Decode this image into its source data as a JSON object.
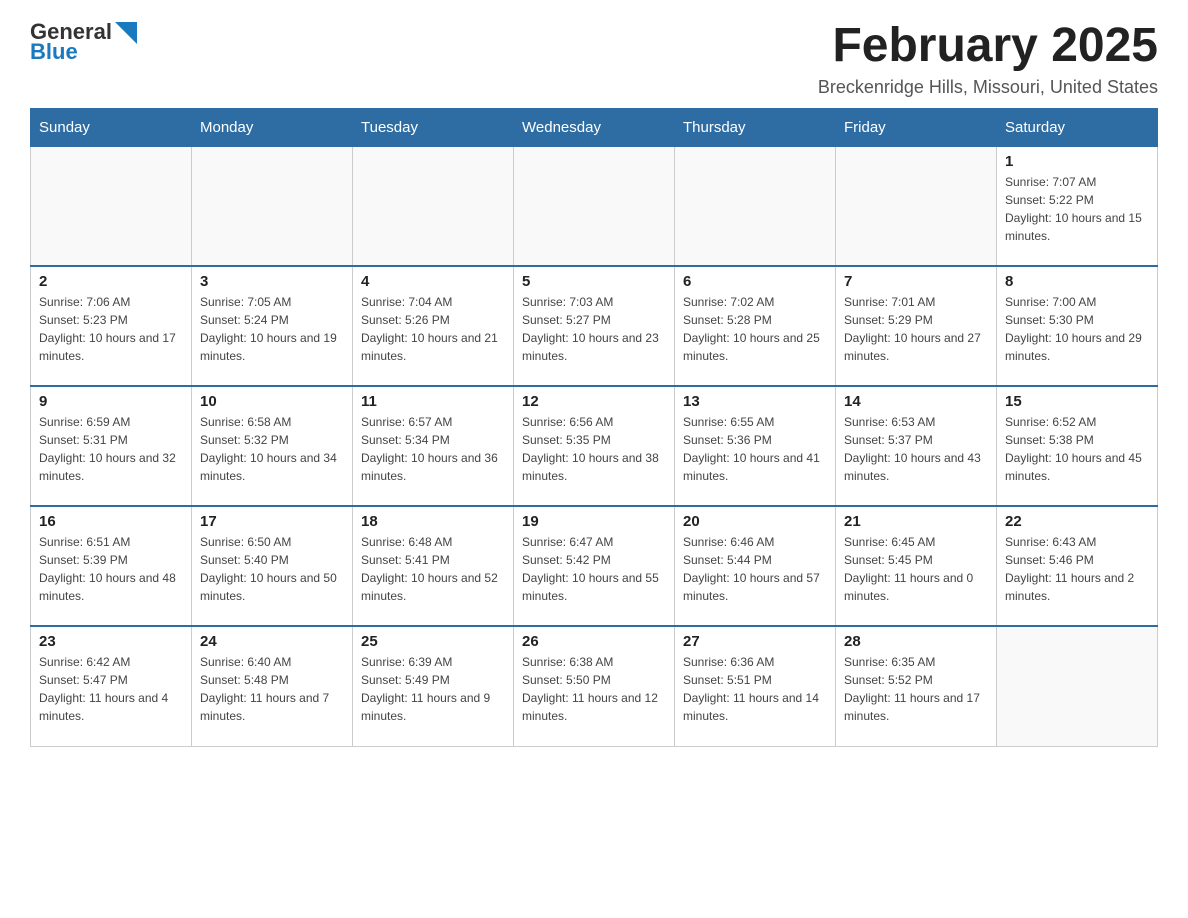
{
  "logo": {
    "text_general": "General",
    "text_blue": "Blue",
    "arrow_color": "#1a7abf"
  },
  "header": {
    "month_title": "February 2025",
    "location": "Breckenridge Hills, Missouri, United States"
  },
  "weekdays": [
    "Sunday",
    "Monday",
    "Tuesday",
    "Wednesday",
    "Thursday",
    "Friday",
    "Saturday"
  ],
  "weeks": [
    [
      {
        "day": "",
        "sunrise": "",
        "sunset": "",
        "daylight": ""
      },
      {
        "day": "",
        "sunrise": "",
        "sunset": "",
        "daylight": ""
      },
      {
        "day": "",
        "sunrise": "",
        "sunset": "",
        "daylight": ""
      },
      {
        "day": "",
        "sunrise": "",
        "sunset": "",
        "daylight": ""
      },
      {
        "day": "",
        "sunrise": "",
        "sunset": "",
        "daylight": ""
      },
      {
        "day": "",
        "sunrise": "",
        "sunset": "",
        "daylight": ""
      },
      {
        "day": "1",
        "sunrise": "Sunrise: 7:07 AM",
        "sunset": "Sunset: 5:22 PM",
        "daylight": "Daylight: 10 hours and 15 minutes."
      }
    ],
    [
      {
        "day": "2",
        "sunrise": "Sunrise: 7:06 AM",
        "sunset": "Sunset: 5:23 PM",
        "daylight": "Daylight: 10 hours and 17 minutes."
      },
      {
        "day": "3",
        "sunrise": "Sunrise: 7:05 AM",
        "sunset": "Sunset: 5:24 PM",
        "daylight": "Daylight: 10 hours and 19 minutes."
      },
      {
        "day": "4",
        "sunrise": "Sunrise: 7:04 AM",
        "sunset": "Sunset: 5:26 PM",
        "daylight": "Daylight: 10 hours and 21 minutes."
      },
      {
        "day": "5",
        "sunrise": "Sunrise: 7:03 AM",
        "sunset": "Sunset: 5:27 PM",
        "daylight": "Daylight: 10 hours and 23 minutes."
      },
      {
        "day": "6",
        "sunrise": "Sunrise: 7:02 AM",
        "sunset": "Sunset: 5:28 PM",
        "daylight": "Daylight: 10 hours and 25 minutes."
      },
      {
        "day": "7",
        "sunrise": "Sunrise: 7:01 AM",
        "sunset": "Sunset: 5:29 PM",
        "daylight": "Daylight: 10 hours and 27 minutes."
      },
      {
        "day": "8",
        "sunrise": "Sunrise: 7:00 AM",
        "sunset": "Sunset: 5:30 PM",
        "daylight": "Daylight: 10 hours and 29 minutes."
      }
    ],
    [
      {
        "day": "9",
        "sunrise": "Sunrise: 6:59 AM",
        "sunset": "Sunset: 5:31 PM",
        "daylight": "Daylight: 10 hours and 32 minutes."
      },
      {
        "day": "10",
        "sunrise": "Sunrise: 6:58 AM",
        "sunset": "Sunset: 5:32 PM",
        "daylight": "Daylight: 10 hours and 34 minutes."
      },
      {
        "day": "11",
        "sunrise": "Sunrise: 6:57 AM",
        "sunset": "Sunset: 5:34 PM",
        "daylight": "Daylight: 10 hours and 36 minutes."
      },
      {
        "day": "12",
        "sunrise": "Sunrise: 6:56 AM",
        "sunset": "Sunset: 5:35 PM",
        "daylight": "Daylight: 10 hours and 38 minutes."
      },
      {
        "day": "13",
        "sunrise": "Sunrise: 6:55 AM",
        "sunset": "Sunset: 5:36 PM",
        "daylight": "Daylight: 10 hours and 41 minutes."
      },
      {
        "day": "14",
        "sunrise": "Sunrise: 6:53 AM",
        "sunset": "Sunset: 5:37 PM",
        "daylight": "Daylight: 10 hours and 43 minutes."
      },
      {
        "day": "15",
        "sunrise": "Sunrise: 6:52 AM",
        "sunset": "Sunset: 5:38 PM",
        "daylight": "Daylight: 10 hours and 45 minutes."
      }
    ],
    [
      {
        "day": "16",
        "sunrise": "Sunrise: 6:51 AM",
        "sunset": "Sunset: 5:39 PM",
        "daylight": "Daylight: 10 hours and 48 minutes."
      },
      {
        "day": "17",
        "sunrise": "Sunrise: 6:50 AM",
        "sunset": "Sunset: 5:40 PM",
        "daylight": "Daylight: 10 hours and 50 minutes."
      },
      {
        "day": "18",
        "sunrise": "Sunrise: 6:48 AM",
        "sunset": "Sunset: 5:41 PM",
        "daylight": "Daylight: 10 hours and 52 minutes."
      },
      {
        "day": "19",
        "sunrise": "Sunrise: 6:47 AM",
        "sunset": "Sunset: 5:42 PM",
        "daylight": "Daylight: 10 hours and 55 minutes."
      },
      {
        "day": "20",
        "sunrise": "Sunrise: 6:46 AM",
        "sunset": "Sunset: 5:44 PM",
        "daylight": "Daylight: 10 hours and 57 minutes."
      },
      {
        "day": "21",
        "sunrise": "Sunrise: 6:45 AM",
        "sunset": "Sunset: 5:45 PM",
        "daylight": "Daylight: 11 hours and 0 minutes."
      },
      {
        "day": "22",
        "sunrise": "Sunrise: 6:43 AM",
        "sunset": "Sunset: 5:46 PM",
        "daylight": "Daylight: 11 hours and 2 minutes."
      }
    ],
    [
      {
        "day": "23",
        "sunrise": "Sunrise: 6:42 AM",
        "sunset": "Sunset: 5:47 PM",
        "daylight": "Daylight: 11 hours and 4 minutes."
      },
      {
        "day": "24",
        "sunrise": "Sunrise: 6:40 AM",
        "sunset": "Sunset: 5:48 PM",
        "daylight": "Daylight: 11 hours and 7 minutes."
      },
      {
        "day": "25",
        "sunrise": "Sunrise: 6:39 AM",
        "sunset": "Sunset: 5:49 PM",
        "daylight": "Daylight: 11 hours and 9 minutes."
      },
      {
        "day": "26",
        "sunrise": "Sunrise: 6:38 AM",
        "sunset": "Sunset: 5:50 PM",
        "daylight": "Daylight: 11 hours and 12 minutes."
      },
      {
        "day": "27",
        "sunrise": "Sunrise: 6:36 AM",
        "sunset": "Sunset: 5:51 PM",
        "daylight": "Daylight: 11 hours and 14 minutes."
      },
      {
        "day": "28",
        "sunrise": "Sunrise: 6:35 AM",
        "sunset": "Sunset: 5:52 PM",
        "daylight": "Daylight: 11 hours and 17 minutes."
      },
      {
        "day": "",
        "sunrise": "",
        "sunset": "",
        "daylight": ""
      }
    ]
  ]
}
